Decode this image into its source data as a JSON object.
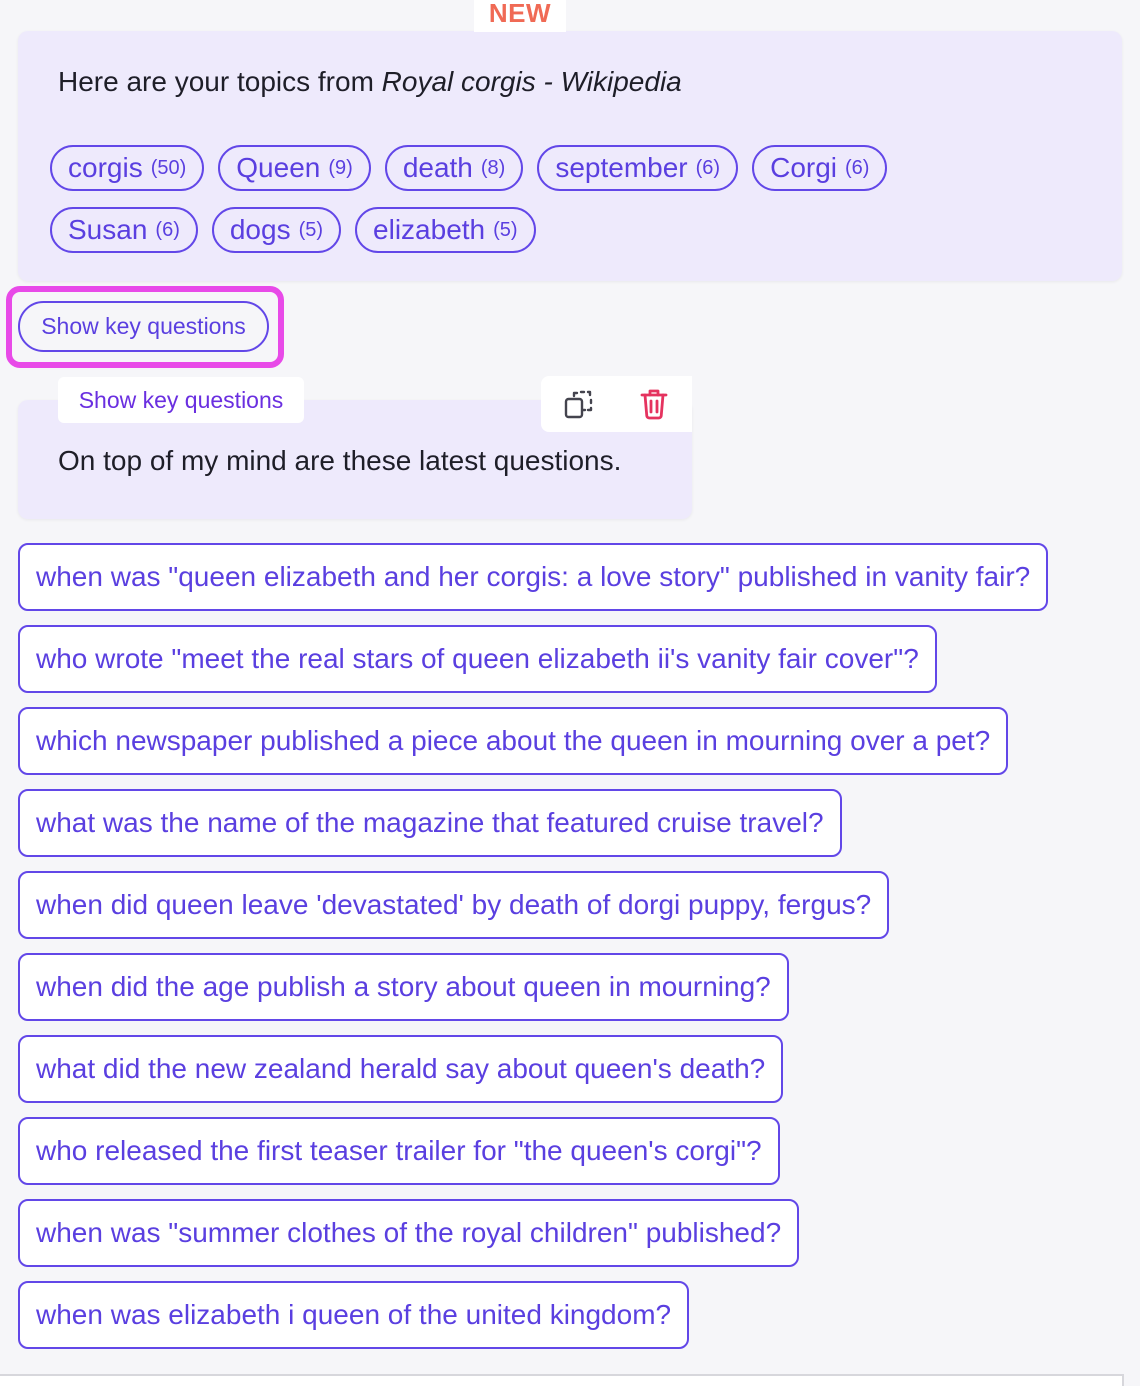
{
  "badge": {
    "label": "NEW"
  },
  "topics": {
    "heading_prefix": "Here are your topics from ",
    "heading_source": "Royal corgis - Wikipedia",
    "row1": [
      {
        "label": "corgis",
        "count": "(50)"
      },
      {
        "label": "Queen",
        "count": "(9)"
      },
      {
        "label": "death",
        "count": "(8)"
      },
      {
        "label": "september",
        "count": "(6)"
      },
      {
        "label": "Corgi",
        "count": "(6)"
      }
    ],
    "row2": [
      {
        "label": "Susan",
        "count": "(6)"
      },
      {
        "label": "dogs",
        "count": "(5)"
      },
      {
        "label": "elizabeth",
        "count": "(5)"
      }
    ]
  },
  "show_key_button": {
    "label": "Show key questions"
  },
  "message": {
    "label": "Show key questions",
    "text": "On top of my mind are these latest questions.",
    "copy_icon": "copy-icon",
    "delete_icon": "trash-icon",
    "delete_color": "#e5335f"
  },
  "questions": [
    "when was \"queen elizabeth and her corgis: a love story\" published in vanity fair?",
    "who wrote \"meet the real stars of queen elizabeth ii's vanity fair cover\"?",
    "which newspaper published a piece about the queen in mourning over a pet?",
    "what was the name of the magazine that featured cruise travel?",
    "when did queen leave 'devastated' by death of dorgi puppy, fergus?",
    "when did the age publish a story about queen in mourning?",
    "what did the new zealand herald say about queen's death?",
    "who released the first teaser trailer for \"the queen's corgi\"?",
    "when was \"summer clothes of the royal children\" published?",
    "when was elizabeth i queen of the united kingdom?"
  ],
  "colors": {
    "accent": "#5a3fe0",
    "card_bg": "#eeeafc",
    "highlight": "#e84ae8",
    "badge": "#f06a55"
  }
}
